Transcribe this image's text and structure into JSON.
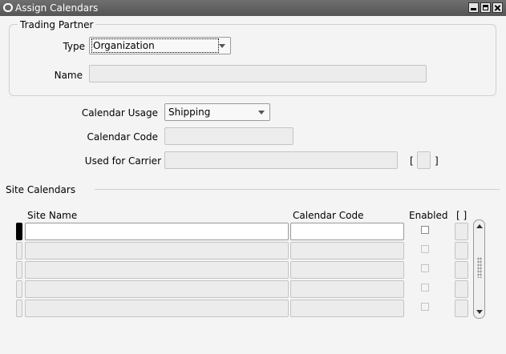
{
  "window": {
    "title": "Assign Calendars",
    "buttons": {
      "minimize": "minimize-icon",
      "maximize": "maximize-icon",
      "close": "close-icon"
    }
  },
  "trading_partner": {
    "legend": "Trading Partner",
    "type_label": "Type",
    "type_value": "Organization",
    "name_label": "Name",
    "name_value": ""
  },
  "calendar": {
    "usage_label": "Calendar Usage",
    "usage_value": "Shipping",
    "code_label": "Calendar Code",
    "code_value": "",
    "carrier_label": "Used for Carrier",
    "carrier_value": "",
    "bracket_open": "[",
    "bracket_close": "]"
  },
  "site_calendars": {
    "title": "Site Calendars",
    "columns": {
      "site_name": "Site Name",
      "calendar_code": "Calendar Code",
      "enabled": "Enabled",
      "extra": "[ ]"
    },
    "rows": [
      {
        "site_name": "",
        "calendar_code": "",
        "enabled": false
      },
      {
        "site_name": "",
        "calendar_code": "",
        "enabled": false
      },
      {
        "site_name": "",
        "calendar_code": "",
        "enabled": false
      },
      {
        "site_name": "",
        "calendar_code": "",
        "enabled": false
      },
      {
        "site_name": "",
        "calendar_code": "",
        "enabled": false
      }
    ]
  }
}
